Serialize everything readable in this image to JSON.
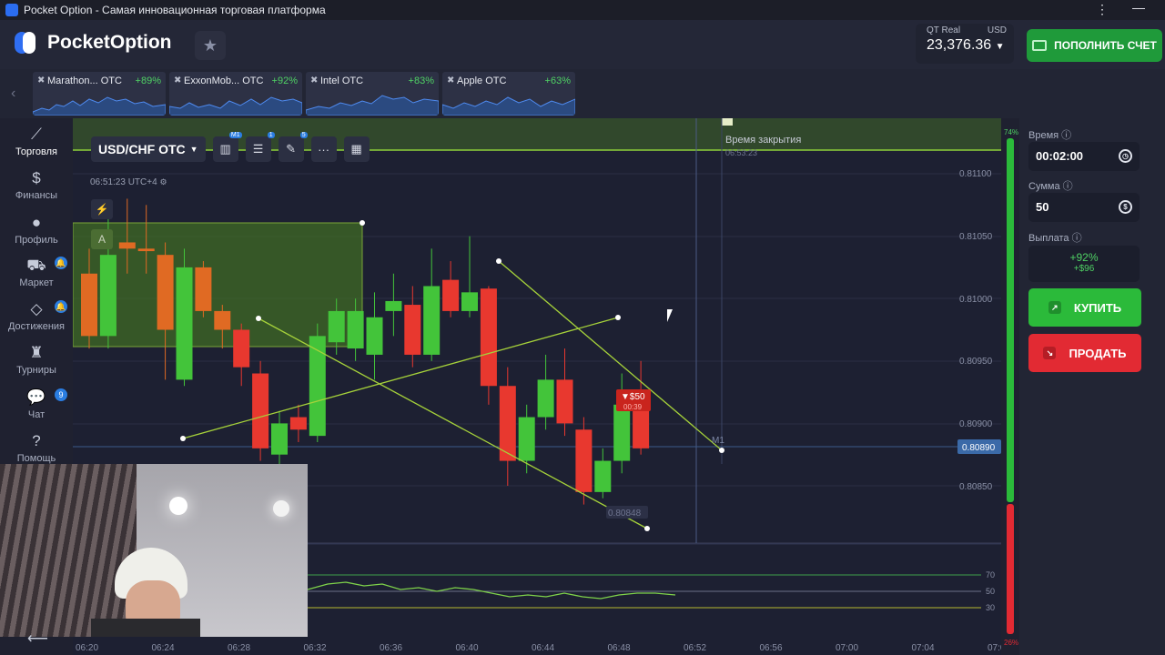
{
  "titlebar": {
    "title": "Pocket Option - Самая инновационная торговая платформа"
  },
  "header": {
    "logo": "PocketOption",
    "account_label": "QT Real",
    "currency": "USD",
    "balance": "23,376.36",
    "deposit_label": "ПОПОЛНИТЬ СЧЕТ"
  },
  "tickers": [
    {
      "name": "Marathon... OTC",
      "pct": "+89%"
    },
    {
      "name": "ExxonMob... OTC",
      "pct": "+92%"
    },
    {
      "name": "Intel OTC",
      "pct": "+83%"
    },
    {
      "name": "Apple OTC",
      "pct": "+63%"
    }
  ],
  "sidebar": {
    "items": [
      {
        "label": "Торговля",
        "icon": "chart-line-icon"
      },
      {
        "label": "Финансы",
        "icon": "dollar-icon"
      },
      {
        "label": "Профиль",
        "icon": "user-icon"
      },
      {
        "label": "Маркет",
        "icon": "cart-icon"
      },
      {
        "label": "Достижения",
        "icon": "diamond-icon"
      },
      {
        "label": "Турниры",
        "icon": "trophy-icon"
      },
      {
        "label": "Чат",
        "icon": "chat-icon",
        "badge": "9"
      },
      {
        "label": "Помощь",
        "icon": "help-icon"
      }
    ]
  },
  "chart": {
    "pair": "USD/CHF OTC",
    "tool_badges": {
      "timeframe": "M1",
      "indicators": "1",
      "drawings": "5"
    },
    "clock": "06:51:23 UTC+4",
    "close_time_label": "Время закрытия",
    "close_time": "06:53:23",
    "price_levels": [
      "0.81100",
      "0.81050",
      "0.81000",
      "0.80950",
      "0.80900",
      "0.80850"
    ],
    "current_price": "0.80890",
    "low_label": "0.80848",
    "trade_badge": "▼$50",
    "trade_timer": "00:39",
    "timeframe_marker": "M1",
    "time_labels": [
      "06:20",
      "06:24",
      "06:28",
      "06:32",
      "06:36",
      "06:40",
      "06:44",
      "06:48",
      "06:52",
      "06:56",
      "07:00",
      "07:04",
      "07:0"
    ],
    "oscillator_levels": [
      "70",
      "50",
      "30"
    ],
    "strength_top": "74%",
    "strength_bottom": "26%",
    "colors": {
      "bull": "#43c43a",
      "bear": "#e8382f",
      "orange": "#e06a23",
      "line": "#9bd23a"
    }
  },
  "panel": {
    "time_label": "Время",
    "time_value": "00:02:00",
    "amount_label": "Сумма",
    "amount_value": "50",
    "payout_label": "Выплата",
    "payout_pct": "+92%",
    "payout_amount": "+$96",
    "buy_label": "КУПИТЬ",
    "sell_label": "ПРОДАТЬ"
  }
}
